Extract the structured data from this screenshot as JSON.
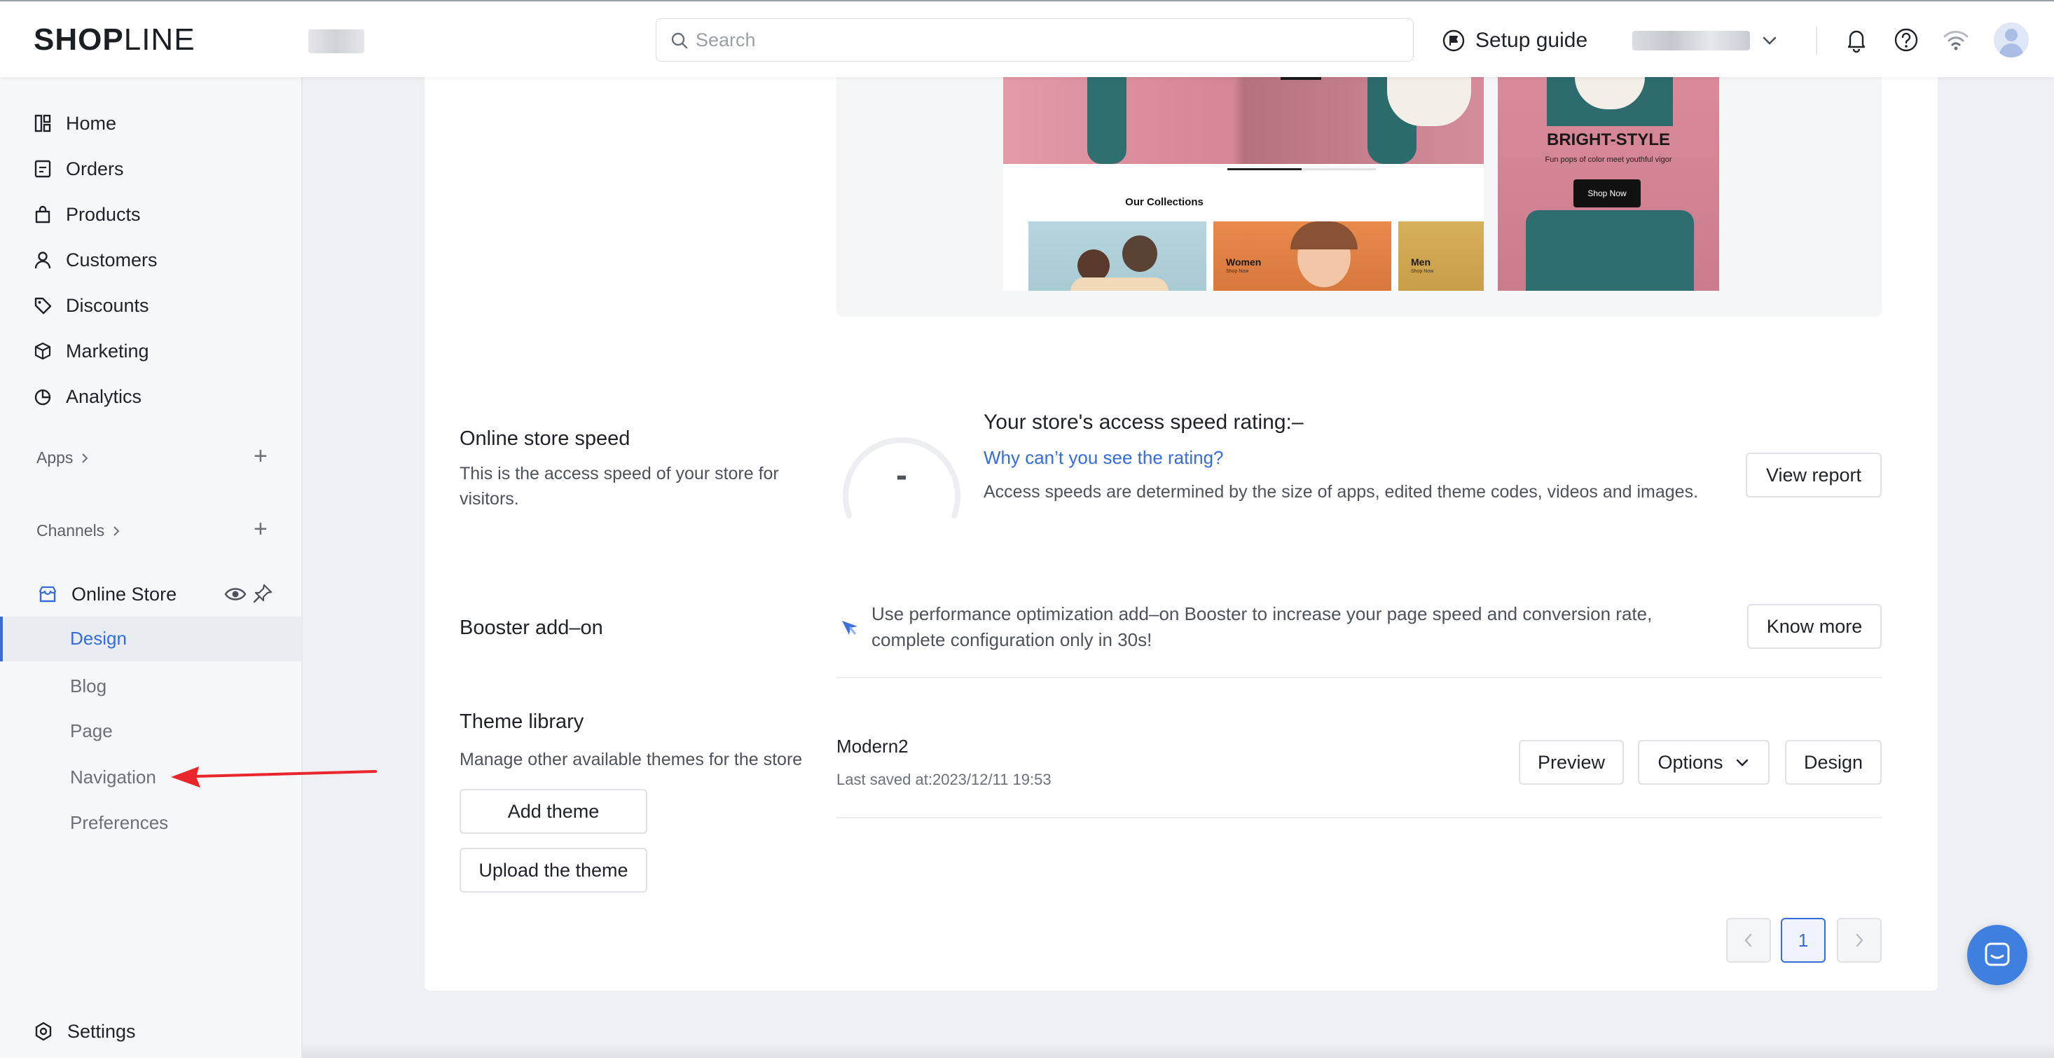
{
  "header": {
    "logo_bold": "SH",
    "logo_o": "O",
    "logo_p": "P",
    "logo_thin": "LINE",
    "search_placeholder": "Search",
    "setup_guide": "Setup guide"
  },
  "sidebar": {
    "items": [
      {
        "label": "Home",
        "icon": "home-icon"
      },
      {
        "label": "Orders",
        "icon": "orders-icon"
      },
      {
        "label": "Products",
        "icon": "bag-icon"
      },
      {
        "label": "Customers",
        "icon": "person-icon"
      },
      {
        "label": "Discounts",
        "icon": "tag-icon"
      },
      {
        "label": "Marketing",
        "icon": "cube-icon"
      },
      {
        "label": "Analytics",
        "icon": "pie-icon"
      }
    ],
    "apps_label": "Apps",
    "channels_label": "Channels",
    "online_store": "Online Store",
    "sub_items": [
      "Design",
      "Blog",
      "Page",
      "Navigation",
      "Preferences"
    ],
    "settings": "Settings"
  },
  "preview": {
    "collections_title": "Our Collections",
    "tile_women": "Women",
    "tile_men": "Men",
    "tile_shop": "Shop Now",
    "mobile_title": "BRIGHT-STYLE",
    "mobile_sub": "Fun pops of color meet youthful vigor",
    "mobile_button": "Shop Now"
  },
  "speed": {
    "title": "Online store speed",
    "desc": "This is the access speed of your store for visitors.",
    "gauge_value": "-",
    "rating": "Your store's access speed rating:–",
    "why_link": "Why can’t you see the rating?",
    "access_text": "Access speeds are determined by the size of apps, edited theme codes, videos and images.",
    "view_report": "View report"
  },
  "booster": {
    "title": "Booster add–on",
    "text": "Use performance optimization add–on Booster to increase your page speed and conversion rate, complete configuration only in 30s!",
    "know_more": "Know more"
  },
  "theme_library": {
    "title": "Theme library",
    "desc": "Manage other available themes for the store",
    "add_theme": "Add theme",
    "upload_theme": "Upload the theme",
    "theme_name": "Modern2",
    "last_saved": "Last saved at:2023/12/11 19:53",
    "preview": "Preview",
    "options": "Options",
    "design": "Design"
  },
  "pagination": {
    "current_page": "1"
  },
  "colors": {
    "accent": "#356dde",
    "arrow": "#e8262b"
  }
}
